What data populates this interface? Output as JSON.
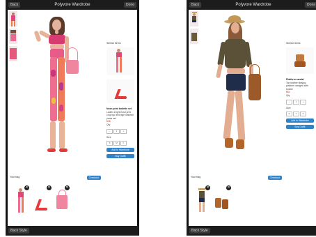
{
  "screens": [
    {
      "id": "left",
      "topbar": {
        "back_label": "Back",
        "title": "Polyvore Wardrobe",
        "edit_label": "Done"
      },
      "product_panel": {
        "title": "Similar items",
        "name": "Neon print bralette set",
        "desc": "Ladies bright floral print crop top and high waisted pants set",
        "price": "$48",
        "qty_label": "Qty",
        "size_label": "Size",
        "add_button": "Add to Wardrobe",
        "buy_button": "Buy Outfit"
      },
      "bag": {
        "label": "Your bag",
        "checkout_button": "Checkout"
      },
      "bottom_label": "Back Style"
    },
    {
      "id": "right",
      "topbar": {
        "back_label": "Back",
        "title": "Polyvore Wardrobe",
        "edit_label": "Done"
      },
      "product_panel": {
        "title": "Similar items",
        "name": "Platform sandal",
        "desc": "Tan leather strappy platform wedges with buckle",
        "price": "$64",
        "qty_label": "Qty",
        "size_label": "Size",
        "add_button": "Add to Wardrobe",
        "buy_button": "Buy Outfit"
      },
      "bag": {
        "label": "Your bag",
        "checkout_button": "Checkout"
      },
      "bottom_label": "Back Style"
    }
  ],
  "colors": {
    "accent_blue": "#2f83c9",
    "pink_outfit": "#e0467a",
    "orange_outfit": "#ef7c3a",
    "olive_top": "#5a5138",
    "denim": "#1f2c4a",
    "tan_shoe": "#b4652a",
    "bag_brown": "#9c5a2a",
    "pink_bag": "#f0859f"
  }
}
